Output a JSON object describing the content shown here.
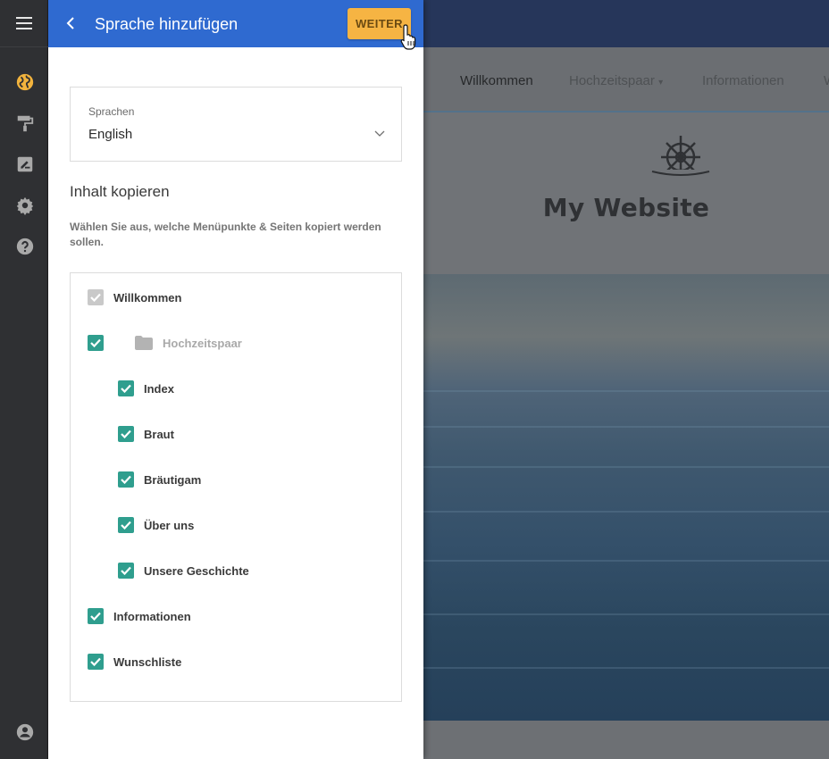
{
  "panel": {
    "title": "Sprache hinzufügen",
    "next_label": "WEITER",
    "language": {
      "label": "Sprachen",
      "value": "English"
    },
    "copy_title": "Inhalt kopieren",
    "copy_description": "Wählen Sie aus, welche Menüpunkte & Seiten kopiert werden sollen.",
    "items": [
      {
        "label": "Willkommen",
        "checked": true,
        "disabled": true
      },
      {
        "label": "Hochzeitspaar",
        "checked": true,
        "folder": true
      },
      {
        "label": "Index",
        "checked": true
      },
      {
        "label": "Braut",
        "checked": true
      },
      {
        "label": "Bräutigam",
        "checked": true
      },
      {
        "label": "Über uns",
        "checked": true
      },
      {
        "label": "Unsere Geschichte",
        "checked": true
      },
      {
        "label": "Informationen",
        "checked": true
      },
      {
        "label": "Wunschliste",
        "checked": true
      }
    ]
  },
  "rail": {
    "icons": [
      "menu-icon",
      "globe-icon",
      "paint-roller-icon",
      "edit-note-icon",
      "gear-icon",
      "help-icon",
      "account-icon"
    ]
  },
  "preview": {
    "nav": [
      "Willkommen",
      "Hochzeitspaar",
      "Informationen",
      "W"
    ],
    "site_title": "My Website"
  },
  "colors": {
    "header_blue": "#2f6ad0",
    "accent_yellow": "#f6b443",
    "checkbox_teal": "#2f9e8e",
    "rail_dark": "#2f3033"
  }
}
